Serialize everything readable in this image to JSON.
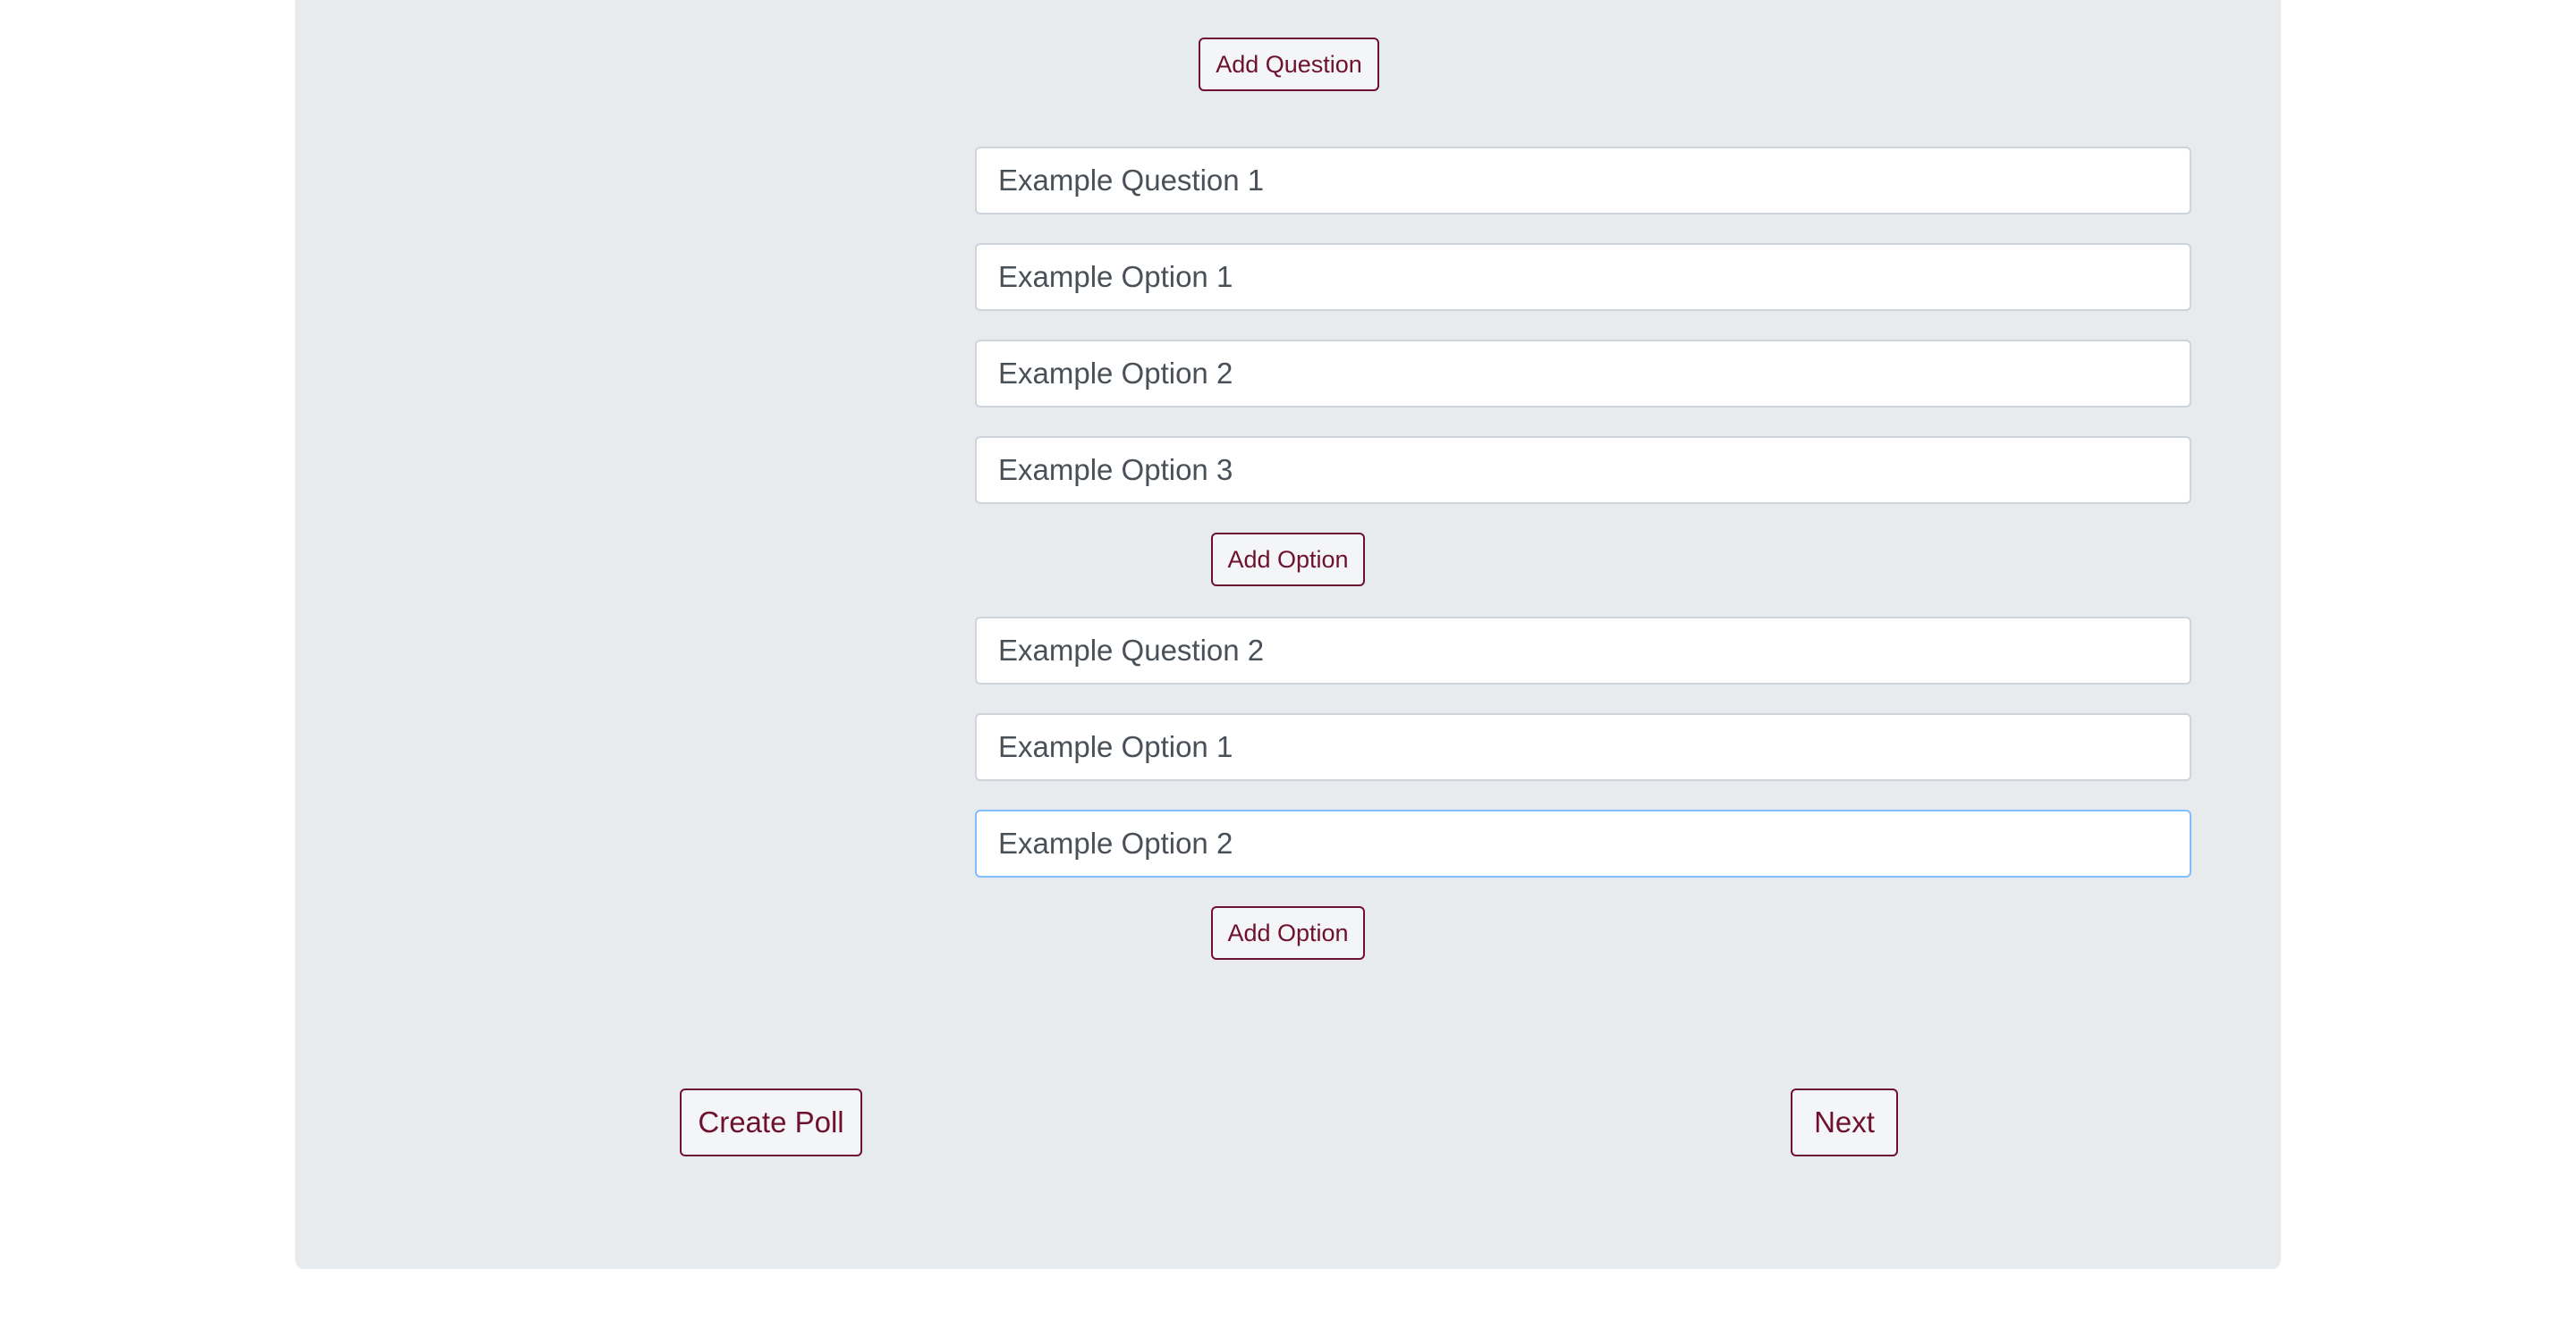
{
  "buttons": {
    "add_question": "Add Question",
    "add_option": "Add Option",
    "create_poll": "Create Poll",
    "next": "Next"
  },
  "questions": [
    {
      "question": "Example Question 1",
      "options": [
        "Example Option 1",
        "Example Option 2",
        "Example Option 3"
      ]
    },
    {
      "question": "Example Question 2",
      "options": [
        "Example Option 1",
        "Example Option 2"
      ]
    }
  ],
  "colors": {
    "accent": "#6e1130",
    "panel_background": "#e8ebee",
    "focus_border": "#80bdff"
  }
}
